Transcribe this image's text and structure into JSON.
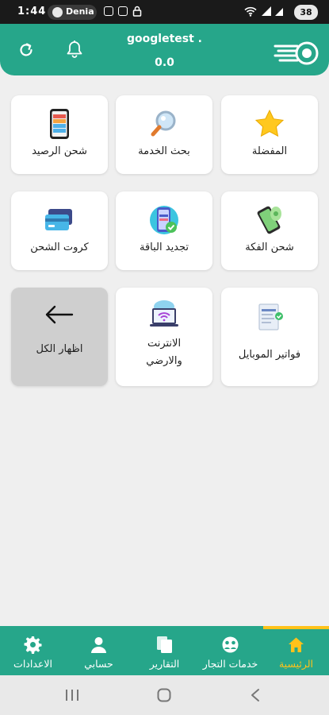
{
  "status_bar": {
    "time": "1:44",
    "pill_label": "Denia",
    "battery": "38"
  },
  "header": {
    "username": "googletest .",
    "balance": "0.0"
  },
  "tiles": [
    {
      "label": "المفضلة",
      "icon": "star-icon"
    },
    {
      "label": "بحث الخدمة",
      "icon": "magnifier-icon"
    },
    {
      "label": "شحن الرصيد",
      "icon": "phone-battery-icon"
    },
    {
      "label": "شحن الفكة",
      "icon": "phone-cash-icon"
    },
    {
      "label": "تجديد الباقة",
      "icon": "phone-renew-icon"
    },
    {
      "label": "كروت الشحن",
      "icon": "cards-icon"
    },
    {
      "label": "فواتير الموبايل",
      "icon": "bill-icon"
    },
    {
      "label_line1": "الانترنت",
      "label_line2": "والارضي",
      "icon": "wifi-laptop-icon"
    },
    {
      "label": "اظهار الكل",
      "icon": "arrow-left-icon"
    }
  ],
  "bottom_nav": [
    {
      "label": "الرئيسية",
      "icon": "home-icon",
      "active": true
    },
    {
      "label": "خدمات التجار",
      "icon": "merchant-icon",
      "active": false
    },
    {
      "label": "التقارير",
      "icon": "reports-icon",
      "active": false
    },
    {
      "label": "حسابي",
      "icon": "user-icon",
      "active": false
    },
    {
      "label": "الاعدادات",
      "icon": "gear-icon",
      "active": false
    }
  ],
  "colors": {
    "primary": "#26a68a",
    "accent": "#ffc21a",
    "background": "#efefef"
  }
}
